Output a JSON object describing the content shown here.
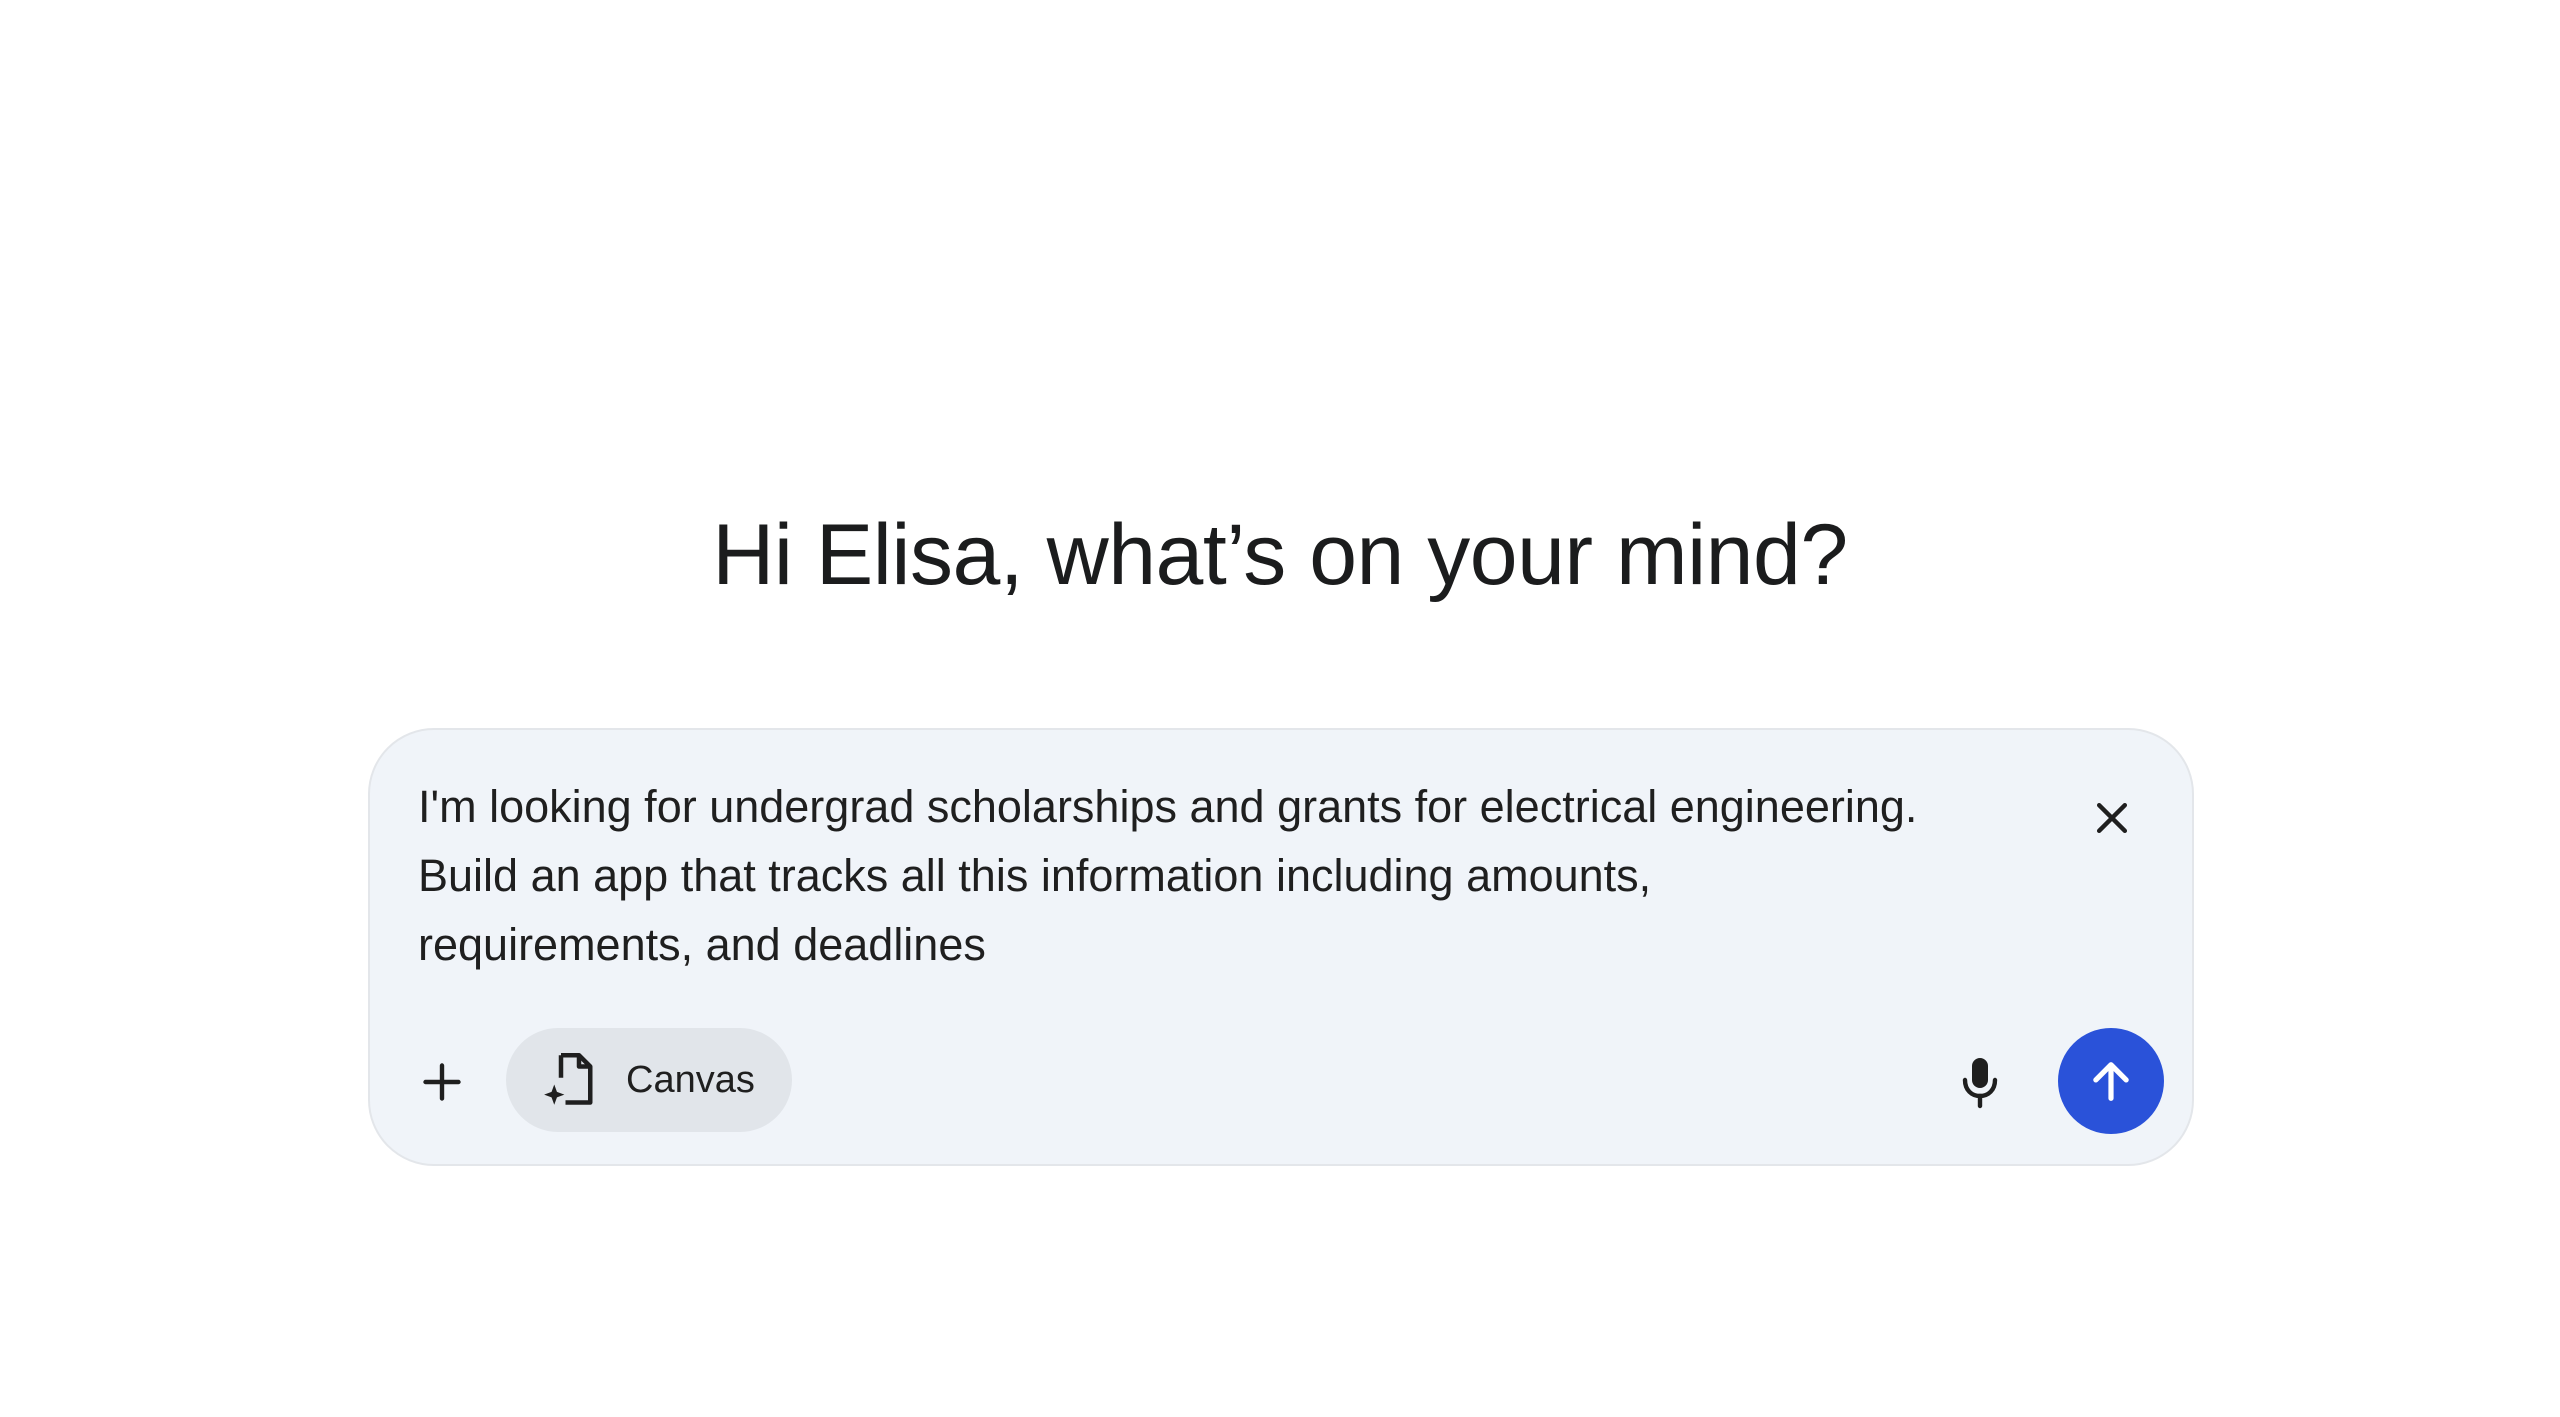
{
  "greeting": "Hi Elisa, what’s on your mind?",
  "composer": {
    "prompt_text": "I'm looking for undergrad scholarships and grants for electrical engineering.\nBuild an app that tracks all this information including amounts,\nrequirements, and deadlines",
    "clear_icon": "close-icon",
    "add_icon": "plus-icon",
    "tool_chip": {
      "label": "Canvas",
      "icon": "canvas-document-icon"
    },
    "mic_icon": "microphone-icon",
    "send_icon": "arrow-up-icon"
  },
  "colors": {
    "composer_background": "#f0f4f9",
    "chip_background": "#e1e5ea",
    "send_button": "#2a52d9",
    "text": "#1f1f1f"
  }
}
